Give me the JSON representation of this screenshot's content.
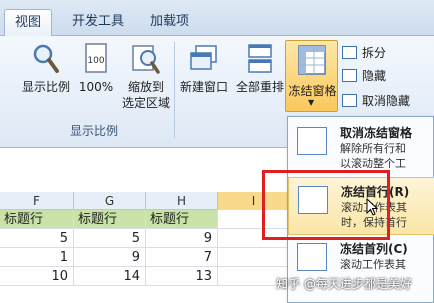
{
  "tabs": [
    "视图",
    "开发工具",
    "加载项"
  ],
  "ribbon": {
    "show_ratio": {
      "buttons": [
        {
          "label": "显示比例"
        },
        {
          "label": "100%"
        },
        {
          "label": "缩放到",
          "label2": "选定区域"
        }
      ],
      "group_label": "显示比例"
    },
    "window": {
      "new_window": "新建窗口",
      "arrange_all": "全部重排",
      "freeze_panes": "冻结窗格",
      "split": "拆分",
      "hide": "隐藏",
      "unhide": "取消隐藏"
    }
  },
  "sheet": {
    "columns": [
      "F",
      "G",
      "H",
      "I"
    ],
    "title_cells": [
      "标题行",
      "标题行",
      "标题行"
    ],
    "rows": [
      [
        "5",
        "5",
        "9"
      ],
      [
        "1",
        "9",
        "7"
      ],
      [
        "10",
        "14",
        "13"
      ]
    ]
  },
  "menu": {
    "items": [
      {
        "title": "取消冻结窗格",
        "desc1": "解除所有行和",
        "desc2": "以滚动整个工"
      },
      {
        "title": "冻结首行(R)",
        "desc1": "滚动工作表其",
        "desc2": "时，保持首行"
      },
      {
        "title": "冻结首列(C)",
        "desc1": "滚动工作表其"
      }
    ]
  },
  "watermark": "知乎 @每天进步都是美好",
  "colors": {
    "title_fill": "#c9e2a8",
    "highlight": "#fbe6a6",
    "frame": "#e02020"
  }
}
